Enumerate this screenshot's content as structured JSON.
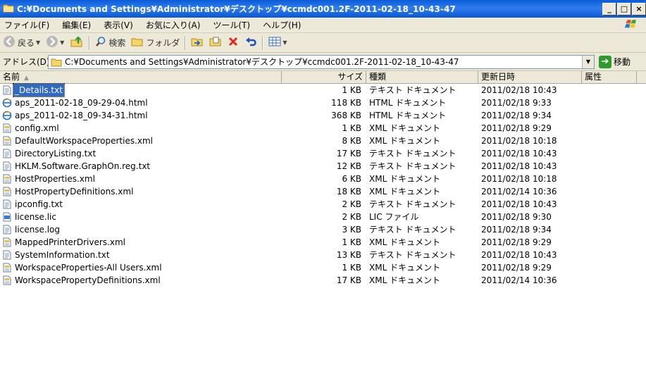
{
  "window": {
    "title": "C:¥Documents and Settings¥Administrator¥デスクトップ¥ccmdc001.2F-2011-02-18_10-43-47",
    "buttons": {
      "minimize": "_",
      "maximize": "□",
      "close": "×"
    }
  },
  "menu": [
    {
      "label": "ファイル(F)"
    },
    {
      "label": "編集(E)"
    },
    {
      "label": "表示(V)"
    },
    {
      "label": "お気に入り(A)"
    },
    {
      "label": "ツール(T)"
    },
    {
      "label": "ヘルプ(H)"
    }
  ],
  "toolbar": {
    "back_label": "戻る",
    "search_label": "検索",
    "folders_label": "フォルダ"
  },
  "address": {
    "label": "アドレス(D)",
    "value": "C:¥Documents and Settings¥Administrator¥デスクトップ¥ccmdc001.2F-2011-02-18_10-43-47",
    "go_label": "移動"
  },
  "columns": {
    "name": "名前",
    "size": "サイズ",
    "type": "種類",
    "date": "更新日時",
    "attr": "属性"
  },
  "files": [
    {
      "name": "_Details.txt",
      "size": "1 KB",
      "type": "テキスト ドキュメント",
      "date": "2011/02/18 10:43",
      "icon": "text-file-icon",
      "selected": true
    },
    {
      "name": "aps_2011-02-18_09-29-04.html",
      "size": "118 KB",
      "type": "HTML ドキュメント",
      "date": "2011/02/18 9:33",
      "icon": "html-file-icon"
    },
    {
      "name": "aps_2011-02-18_09-34-31.html",
      "size": "368 KB",
      "type": "HTML ドキュメント",
      "date": "2011/02/18 9:34",
      "icon": "html-file-icon"
    },
    {
      "name": "config.xml",
      "size": "1 KB",
      "type": "XML ドキュメント",
      "date": "2011/02/18 9:29",
      "icon": "xml-file-icon"
    },
    {
      "name": "DefaultWorkspaceProperties.xml",
      "size": "8 KB",
      "type": "XML ドキュメント",
      "date": "2011/02/18 10:18",
      "icon": "xml-file-icon"
    },
    {
      "name": "DirectoryListing.txt",
      "size": "17 KB",
      "type": "テキスト ドキュメント",
      "date": "2011/02/18 10:43",
      "icon": "text-file-icon"
    },
    {
      "name": "HKLM.Software.GraphOn.reg.txt",
      "size": "12 KB",
      "type": "テキスト ドキュメント",
      "date": "2011/02/18 10:43",
      "icon": "text-file-icon"
    },
    {
      "name": "HostProperties.xml",
      "size": "6 KB",
      "type": "XML ドキュメント",
      "date": "2011/02/18 10:18",
      "icon": "xml-file-icon"
    },
    {
      "name": "HostPropertyDefinitions.xml",
      "size": "18 KB",
      "type": "XML ドキュメント",
      "date": "2011/02/14 10:36",
      "icon": "xml-file-icon"
    },
    {
      "name": "ipconfig.txt",
      "size": "2 KB",
      "type": "テキスト ドキュメント",
      "date": "2011/02/18 10:43",
      "icon": "text-file-icon"
    },
    {
      "name": "license.lic",
      "size": "2 KB",
      "type": "LIC ファイル",
      "date": "2011/02/18 9:30",
      "icon": "lic-file-icon"
    },
    {
      "name": "license.log",
      "size": "3 KB",
      "type": "テキスト ドキュメント",
      "date": "2011/02/18 9:34",
      "icon": "text-file-icon"
    },
    {
      "name": "MappedPrinterDrivers.xml",
      "size": "1 KB",
      "type": "XML ドキュメント",
      "date": "2011/02/18 9:29",
      "icon": "xml-file-icon"
    },
    {
      "name": "SystemInformation.txt",
      "size": "13 KB",
      "type": "テキスト ドキュメント",
      "date": "2011/02/18 10:43",
      "icon": "text-file-icon"
    },
    {
      "name": "WorkspaceProperties-All Users.xml",
      "size": "1 KB",
      "type": "XML ドキュメント",
      "date": "2011/02/18 9:29",
      "icon": "xml-file-icon"
    },
    {
      "name": "WorkspacePropertyDefinitions.xml",
      "size": "17 KB",
      "type": "XML ドキュメント",
      "date": "2011/02/14 10:36",
      "icon": "xml-file-icon"
    }
  ],
  "colors": {
    "titlebar": "#0a5bd6",
    "selection": "#316ac5"
  }
}
